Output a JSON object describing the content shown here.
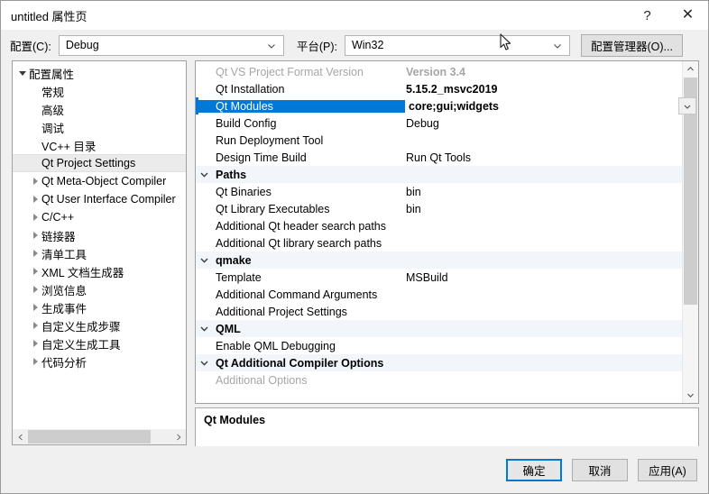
{
  "window": {
    "title": "untitled 属性页",
    "help_icon": "?",
    "close_icon": "✕"
  },
  "toolbar": {
    "config_label": "配置(C):",
    "config_value": "Debug",
    "platform_label": "平台(P):",
    "platform_value": "Win32",
    "config_manager_button": "配置管理器(O)...",
    "dropdown_icon": "chevron-down-icon"
  },
  "tree": {
    "items": [
      {
        "label": "配置属性",
        "depth": 0,
        "expander": "down",
        "selected": false
      },
      {
        "label": "常规",
        "depth": 1,
        "expander": "none",
        "selected": false
      },
      {
        "label": "高级",
        "depth": 1,
        "expander": "none",
        "selected": false
      },
      {
        "label": "调试",
        "depth": 1,
        "expander": "none",
        "selected": false
      },
      {
        "label": "VC++ 目录",
        "depth": 1,
        "expander": "none",
        "selected": false
      },
      {
        "label": "Qt Project Settings",
        "depth": 1,
        "expander": "none",
        "selected": true
      },
      {
        "label": "Qt Meta-Object Compiler",
        "depth": 1,
        "expander": "right",
        "selected": false
      },
      {
        "label": "Qt User Interface Compiler",
        "depth": 1,
        "expander": "right",
        "selected": false
      },
      {
        "label": "C/C++",
        "depth": 1,
        "expander": "right",
        "selected": false
      },
      {
        "label": "链接器",
        "depth": 1,
        "expander": "right",
        "selected": false
      },
      {
        "label": "清单工具",
        "depth": 1,
        "expander": "right",
        "selected": false
      },
      {
        "label": "XML 文档生成器",
        "depth": 1,
        "expander": "right",
        "selected": false
      },
      {
        "label": "浏览信息",
        "depth": 1,
        "expander": "right",
        "selected": false
      },
      {
        "label": "生成事件",
        "depth": 1,
        "expander": "right",
        "selected": false
      },
      {
        "label": "自定义生成步骤",
        "depth": 1,
        "expander": "right",
        "selected": false
      },
      {
        "label": "自定义生成工具",
        "depth": 1,
        "expander": "right",
        "selected": false
      },
      {
        "label": "代码分析",
        "depth": 1,
        "expander": "right",
        "selected": false
      }
    ],
    "hscroll_left_icon": "chevron-left-icon",
    "hscroll_right_icon": "chevron-right-icon"
  },
  "grid": {
    "rows": [
      {
        "kind": "prop",
        "name": "Qt VS Project Format Version",
        "value": "Version 3.4",
        "name_style": "dim",
        "value_style": "bold-dim",
        "selected": false
      },
      {
        "kind": "prop",
        "name": "Qt Installation",
        "value": "5.15.2_msvc2019",
        "name_style": "normal",
        "value_style": "bold",
        "selected": false
      },
      {
        "kind": "prop",
        "name": "Qt Modules",
        "value": "core;gui;widgets",
        "name_style": "normal",
        "value_style": "bold",
        "selected": true
      },
      {
        "kind": "prop",
        "name": "Build Config",
        "value": "Debug",
        "name_style": "normal",
        "value_style": "normal",
        "selected": false
      },
      {
        "kind": "prop",
        "name": "Run Deployment Tool",
        "value": "",
        "name_style": "normal",
        "value_style": "normal",
        "selected": false
      },
      {
        "kind": "prop",
        "name": "Design Time Build",
        "value": "Run Qt Tools",
        "name_style": "normal",
        "value_style": "normal",
        "selected": false
      },
      {
        "kind": "group",
        "name": "Paths",
        "value": "",
        "name_style": "bold",
        "value_style": "normal",
        "selected": false
      },
      {
        "kind": "prop",
        "name": "Qt Binaries",
        "value": "bin",
        "name_style": "normal",
        "value_style": "normal",
        "selected": false
      },
      {
        "kind": "prop",
        "name": "Qt Library Executables",
        "value": "bin",
        "name_style": "normal",
        "value_style": "normal",
        "selected": false
      },
      {
        "kind": "prop",
        "name": "Additional Qt header search paths",
        "value": "",
        "name_style": "normal",
        "value_style": "normal",
        "selected": false
      },
      {
        "kind": "prop",
        "name": "Additional Qt library search paths",
        "value": "",
        "name_style": "normal",
        "value_style": "normal",
        "selected": false
      },
      {
        "kind": "group",
        "name": "qmake",
        "value": "",
        "name_style": "bold",
        "value_style": "normal",
        "selected": false
      },
      {
        "kind": "prop",
        "name": "Template",
        "value": "MSBuild",
        "name_style": "normal",
        "value_style": "normal",
        "selected": false
      },
      {
        "kind": "prop",
        "name": "Additional Command Arguments",
        "value": "",
        "name_style": "normal",
        "value_style": "normal",
        "selected": false
      },
      {
        "kind": "prop",
        "name": "Additional Project Settings",
        "value": "",
        "name_style": "normal",
        "value_style": "normal",
        "selected": false
      },
      {
        "kind": "group",
        "name": "QML",
        "value": "",
        "name_style": "bold",
        "value_style": "normal",
        "selected": false
      },
      {
        "kind": "prop",
        "name": "Enable QML Debugging",
        "value": "",
        "name_style": "normal",
        "value_style": "normal",
        "selected": false
      },
      {
        "kind": "group",
        "name": "Qt Additional Compiler Options",
        "value": "",
        "name_style": "bold",
        "value_style": "normal",
        "selected": false
      },
      {
        "kind": "prop",
        "name": "Additional Options",
        "value": "",
        "name_style": "dim",
        "value_style": "normal",
        "selected": false
      }
    ],
    "value_dropdown_icon": "chevron-down-icon",
    "vscroll_up_icon": "chevron-up-icon",
    "vscroll_down_icon": "chevron-down-icon"
  },
  "description": {
    "title": "Qt Modules",
    "text": ""
  },
  "footer": {
    "ok": "确定",
    "cancel": "取消",
    "apply": "应用(A)"
  },
  "colors": {
    "selection_blue": "#0078d7",
    "dialog_bg": "#f0f0f0",
    "panel_bg": "#ffffff",
    "group_row_bg": "#f2f5fa",
    "tree_selection": "#ebebeb",
    "scroll_thumb": "#cdcdcd"
  }
}
